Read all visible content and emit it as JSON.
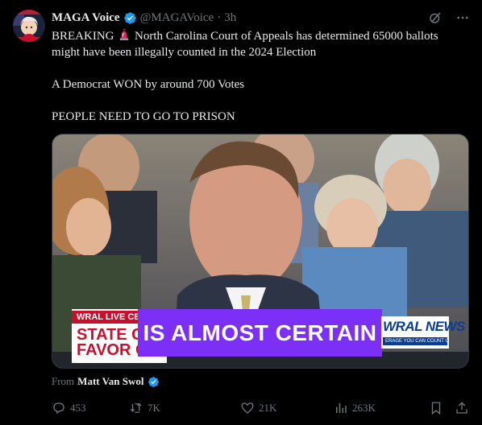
{
  "author": {
    "name": "MAGA Voice",
    "handle": "@MAGAVoice",
    "separator": "·",
    "time": "3h",
    "verified_icon": "verified-badge-icon",
    "accent": "#1d9bf0"
  },
  "header_icons": [
    "grok-icon",
    "more-icon"
  ],
  "tweet": {
    "line1_a": "BREAKING",
    "line1_b": "North Carolina Court of Appeals has determined 65000 ballots might have been illegally counted in the 2024 Election",
    "line2": "A Democrat WON by around 700 Votes",
    "line3": "PEOPLE NEED TO GO TO PRISON",
    "emoji": "police-light-icon"
  },
  "media": {
    "chyron_live": "WRAL LIVE CEN",
    "chyron_line1": "STATE CO",
    "chyron_line2": "FAVOR O",
    "headline": "IS ALMOST CERTAIN",
    "logo_text": "WRAL NEWS",
    "logo_tag": "ERAGE YOU CAN COUNT ON",
    "headline_color": "#7b2ff7",
    "chyron_color": "#c8102e"
  },
  "attribution": {
    "prefix": "From",
    "name": "Matt Van Swol"
  },
  "actions": {
    "replies": "453",
    "reposts": "7K",
    "likes": "21K",
    "views": "263K"
  },
  "colors": {
    "background": "#000000",
    "text": "#e7e9ea",
    "muted": "#71767b",
    "verified": "#1d9bf0"
  }
}
